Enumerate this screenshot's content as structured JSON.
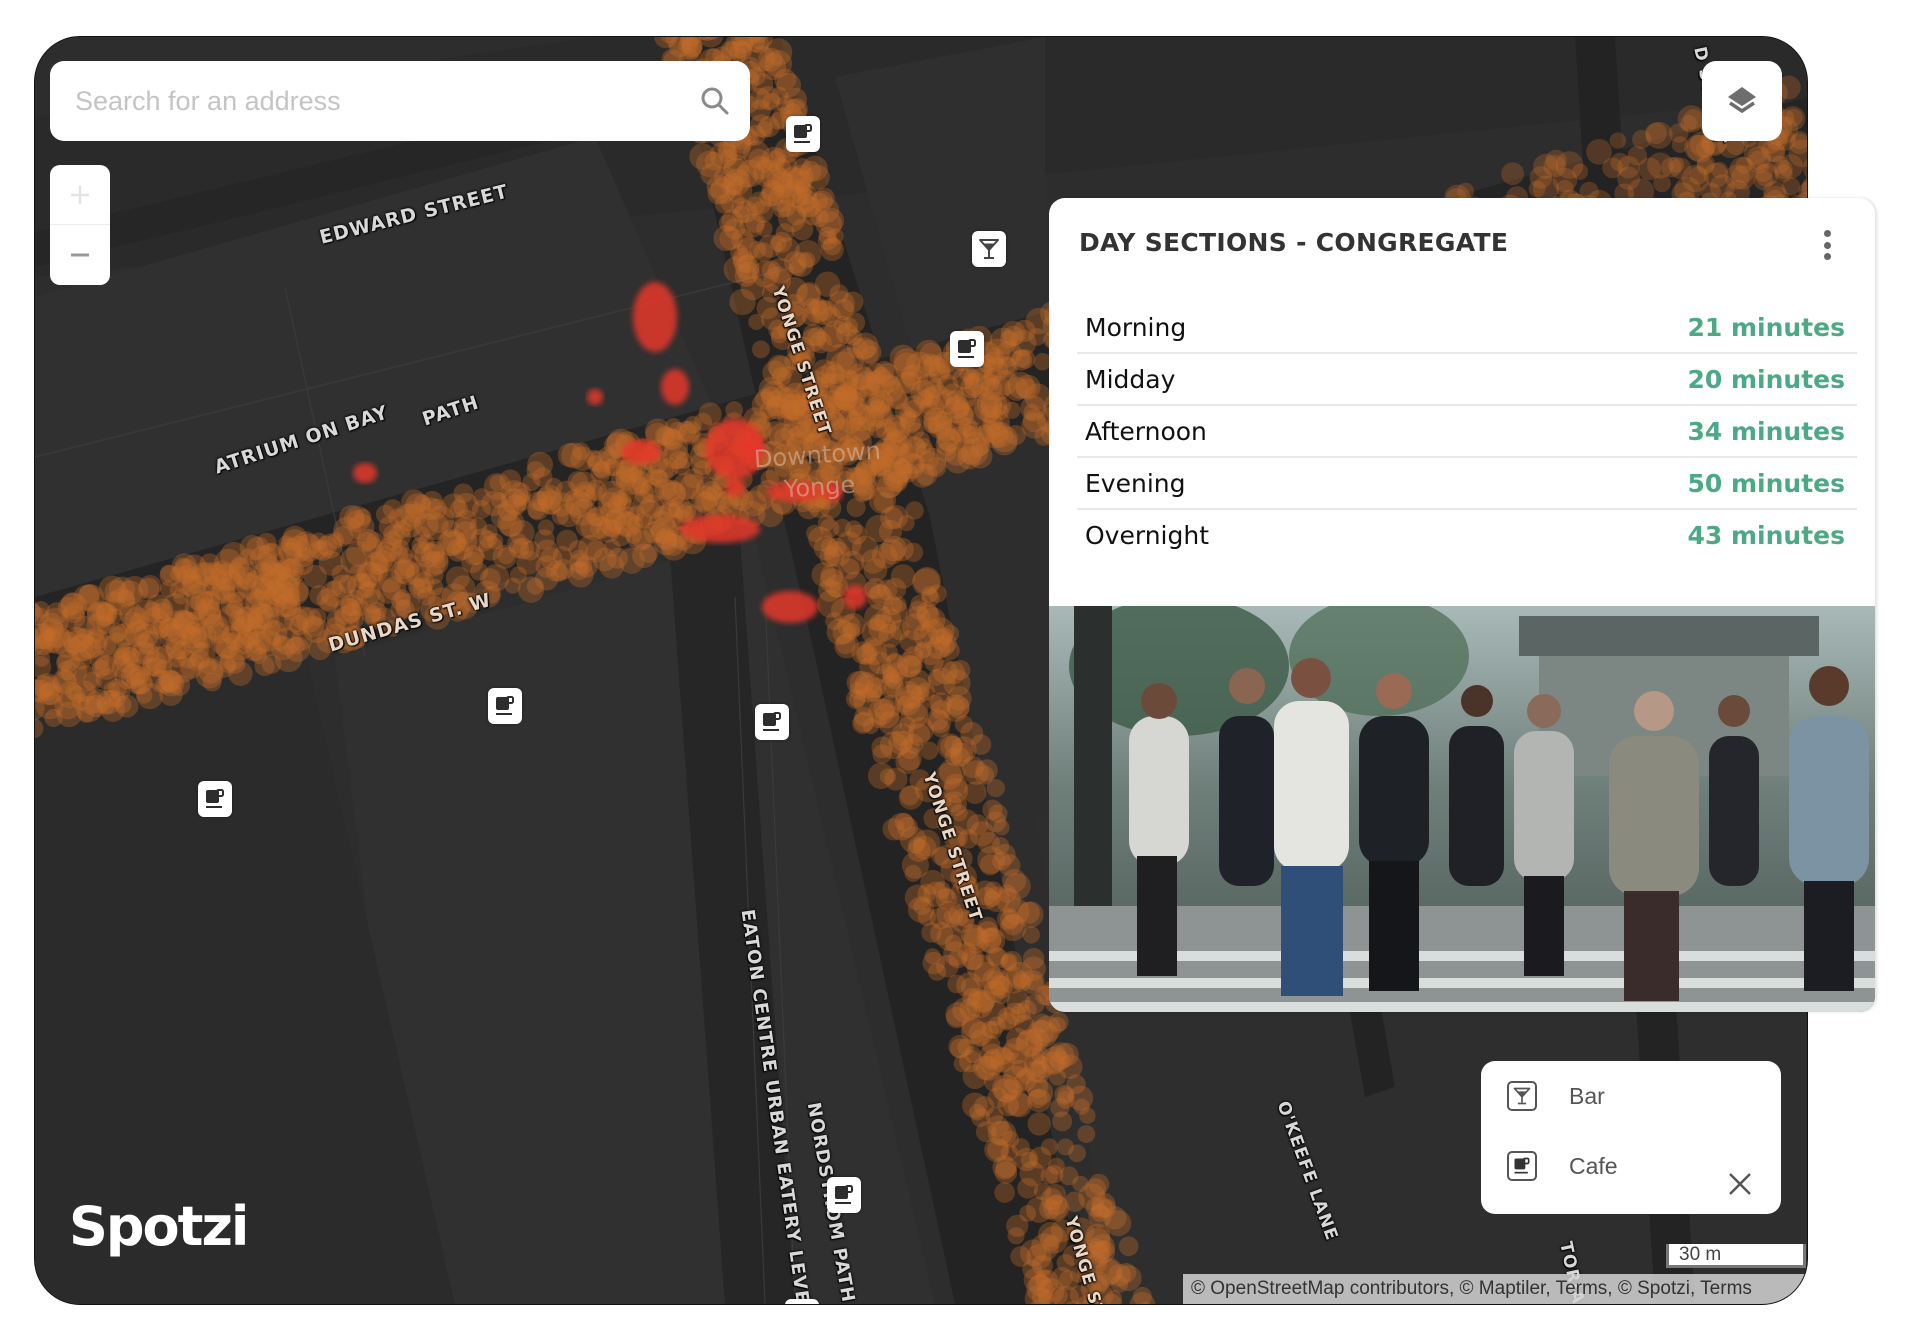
{
  "search": {
    "placeholder": "Search for an address",
    "value": ""
  },
  "zoom_controls": {
    "zoom_in": "+",
    "zoom_out": "−",
    "zoom_in_enabled": false
  },
  "layers_button": {
    "icon": "layers-icon"
  },
  "map": {
    "street_labels": [
      "EDWARD STREET",
      "ATRIUM ON BAY",
      "PATH",
      "DUNDAS ST. W",
      "YONGE STREET",
      "YONGE STREET",
      "YONGE ST",
      "EATON CENTRE URBAN EATERY LEVEL",
      "NORDSTROM PATH",
      "O'KEEFE LANE",
      "D STREET",
      "TORIA"
    ],
    "district_label": [
      "Downtown",
      "Yonge"
    ],
    "heatmap": {
      "low_color": "#c46d2a",
      "high_color": "#e5372a",
      "description": "foot-traffic density along Yonge Street and Dundas St. W"
    },
    "markers": [
      {
        "type": "cafe",
        "icon": "cafe-icon"
      },
      {
        "type": "bar",
        "icon": "bar-icon"
      },
      {
        "type": "cafe",
        "icon": "cafe-icon"
      },
      {
        "type": "cafe",
        "icon": "cafe-icon"
      },
      {
        "type": "cafe",
        "icon": "cafe-icon"
      },
      {
        "type": "cafe",
        "icon": "cafe-icon"
      },
      {
        "type": "cafe",
        "icon": "cafe-icon"
      },
      {
        "type": "cafe",
        "icon": "cafe-icon"
      }
    ]
  },
  "info_panel": {
    "title": "DAY SECTIONS - CONGREGATE",
    "rows": [
      {
        "label": "Morning",
        "value": "21 minutes"
      },
      {
        "label": "Midday",
        "value": "20 minutes"
      },
      {
        "label": "Afternoon",
        "value": "34 minutes"
      },
      {
        "label": "Evening",
        "value": "50 minutes"
      },
      {
        "label": "Overnight",
        "value": "43 minutes"
      }
    ],
    "value_color": "#4ca885",
    "photo_description": "Crowd of pedestrians crossing a city street"
  },
  "legend": {
    "items": [
      {
        "label": "Bar",
        "icon": "bar-icon"
      },
      {
        "label": "Cafe",
        "icon": "cafe-icon"
      }
    ]
  },
  "brand": {
    "logo_text": "Spotzi"
  },
  "scale": {
    "label": "30 m"
  },
  "attribution": {
    "osm": "© OpenStreetMap contributors",
    "maptiler": "© Maptiler",
    "terms1": "Terms",
    "spotzi": "© Spotzi",
    "terms2": "Terms"
  }
}
